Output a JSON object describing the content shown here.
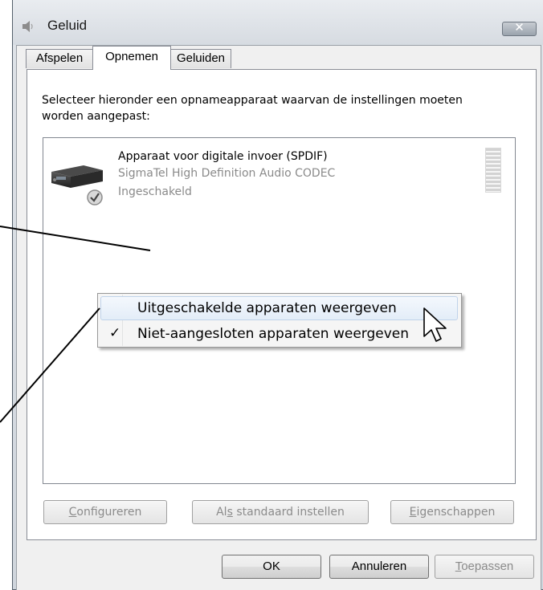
{
  "window": {
    "title": "Geluid",
    "close_glyph": "✕"
  },
  "tabs": [
    {
      "label": "Afspelen",
      "active": false
    },
    {
      "label": "Opnemen",
      "active": true
    },
    {
      "label": "Geluiden",
      "active": false
    }
  ],
  "instructions": "Selecteer hieronder een opnameapparaat waarvan de instellingen moeten worden aangepast:",
  "device": {
    "name": "Apparaat voor digitale invoer (SPDIF)",
    "driver": "SigmaTel High Definition Audio CODEC",
    "status": "Ingeschakeld",
    "icon": "spdif-device-icon",
    "status_icon": "checkmark-badge-icon"
  },
  "context_menu": {
    "items": [
      {
        "label": "Uitgeschakelde apparaten weergeven",
        "checked": false,
        "highlighted": true
      },
      {
        "label": "Niet-aangesloten apparaten weergeven",
        "checked": true
      }
    ],
    "check_glyph": "✓"
  },
  "device_buttons": {
    "configure": {
      "pre": "",
      "key": "C",
      "post": "onfigureren"
    },
    "set_default": {
      "pre": "Al",
      "key": "s",
      "post": " standaard instellen"
    },
    "properties": {
      "pre": "",
      "key": "E",
      "post": "igenschappen"
    }
  },
  "dialog_buttons": {
    "ok": "OK",
    "cancel": "Annuleren",
    "apply": {
      "key": "T",
      "post": "oepassen"
    }
  },
  "colors": {
    "accent_highlight": "#e3edf8",
    "disabled_text": "#8b8b8b",
    "secondary_text": "#8a8a8a"
  }
}
